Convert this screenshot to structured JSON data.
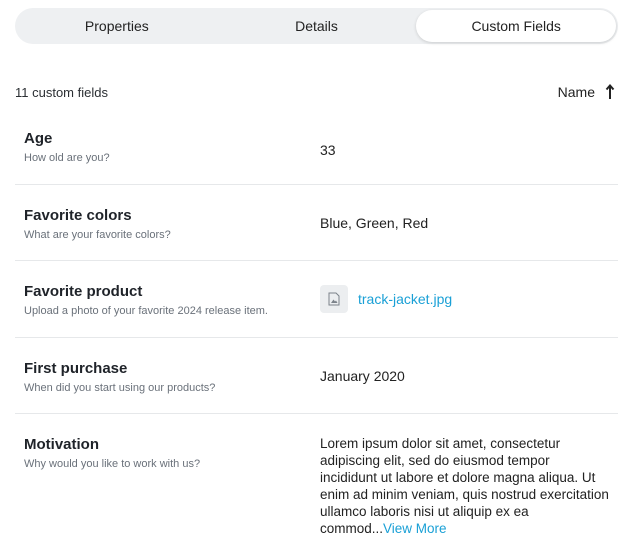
{
  "tabs": [
    {
      "label": "Properties",
      "active": false
    },
    {
      "label": "Details",
      "active": false
    },
    {
      "label": "Custom Fields",
      "active": true
    }
  ],
  "summary": {
    "count_text": "11 custom fields",
    "sort_label": "Name",
    "sort_icon": "arrow-up-icon"
  },
  "fields": [
    {
      "name": "Age",
      "description": "How old are you?",
      "value": "33"
    },
    {
      "name": "Favorite colors",
      "description": "What are your favorite colors?",
      "value": "Blue, Green, Red"
    },
    {
      "name": "Favorite product",
      "description": "Upload a photo of your favorite 2024 release item.",
      "file_name": "track-jacket.jpg",
      "file_icon": "image-file-icon"
    },
    {
      "name": "First purchase",
      "description": "When did you start using our products?",
      "value": "January 2020"
    },
    {
      "name": "Motivation",
      "description": "Why would you like to work with us?",
      "value": "Lorem ipsum dolor sit amet, consectetur adipiscing elit, sed do eiusmod tempor incididunt ut labore et dolore magna aliqua. Ut enim ad minim veniam, quis nostrud exercitation ullamco laboris nisi ut aliquip ex ea commod...",
      "more_label": "View More"
    }
  ],
  "colors": {
    "link": "#1aa0d6",
    "tab_track": "#eef0f2",
    "divider": "#e6e8ea"
  }
}
